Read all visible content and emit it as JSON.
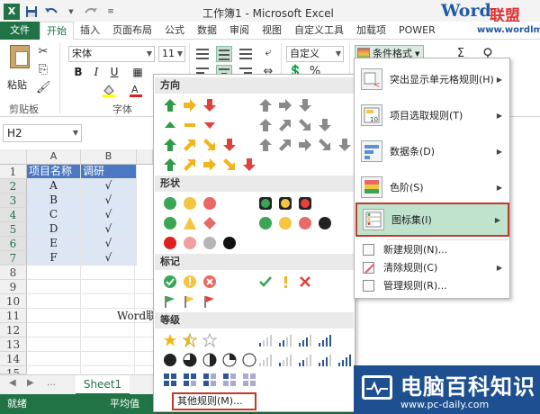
{
  "window": {
    "title": "工作簿1 - Microsoft Excel",
    "logo_word": "Word",
    "logo_cn": "联盟",
    "logo_url": "www.wordlm.com"
  },
  "ribbon": {
    "tabs": [
      "文件",
      "开始",
      "插入",
      "页面布局",
      "公式",
      "数据",
      "审阅",
      "视图",
      "自定义工具",
      "加载项",
      "POWER"
    ],
    "paste_label": "粘贴",
    "font_name": "宋体",
    "font_size": "11",
    "number_format": "自定义",
    "conditional_format_label": "条件格式",
    "clipboard_group": "剪贴板",
    "font_group": "字体"
  },
  "namebox": "H2",
  "sheet": {
    "columns": [
      "A",
      "B"
    ],
    "rows": [
      "1",
      "2",
      "3",
      "4",
      "5",
      "6",
      "7",
      "8",
      "9",
      "10",
      "11",
      "12",
      "13",
      "14",
      "15"
    ],
    "header_cells": [
      "项目名称",
      "调研"
    ],
    "data_rows": [
      [
        "A",
        "√"
      ],
      [
        "B",
        "√"
      ],
      [
        "C",
        "√"
      ],
      [
        "D",
        "√"
      ],
      [
        "E",
        "√"
      ],
      [
        "F",
        "√"
      ]
    ],
    "row11_text": "Word联"
  },
  "sheet_tabs": [
    "Sheet1"
  ],
  "status": {
    "ready": "就绪",
    "average": "平均值"
  },
  "gallery": {
    "sections": [
      "方向",
      "形状",
      "标记",
      "等级"
    ],
    "more_rules": "其他规则(M)..."
  },
  "cf_menu": {
    "items": [
      "突出显示单元格规则(H)",
      "项目选取规则(T)",
      "数据条(D)",
      "色阶(S)",
      "图标集(I)"
    ],
    "small_items": [
      "新建规则(N)...",
      "清除规则(C)",
      "管理规则(R)..."
    ]
  },
  "badge": {
    "text": "电脑百科知识",
    "site": "www.pc-daily.com"
  },
  "colors": {
    "excel_green": "#217346",
    "header_blue": "#4a78c2",
    "data_fill": "#dde6f5",
    "highlight_red": "#c0392b",
    "menu_selected": "#bfe3cd"
  }
}
